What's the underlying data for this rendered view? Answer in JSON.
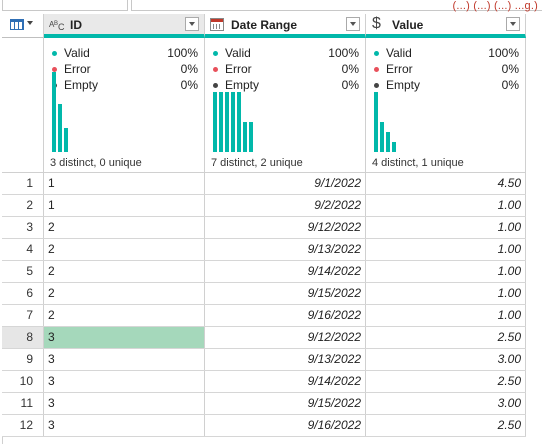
{
  "formula_bar": {
    "tail_text": "(...) (...) (...) ...g.)"
  },
  "columns": [
    {
      "name": "ID",
      "type_icon": "text-type-icon",
      "type_label": "ABC",
      "quality": {
        "valid": "100%",
        "error": "0%",
        "empty": "0%"
      },
      "distribution": [
        80,
        48,
        24
      ],
      "distinct": "3 distinct, 0 unique"
    },
    {
      "name": "Date Range",
      "type_icon": "date-type-icon",
      "quality": {
        "valid": "100%",
        "error": "0%",
        "empty": "0%"
      },
      "distribution": [
        60,
        60,
        60,
        60,
        60,
        30,
        30
      ],
      "distinct": "7 distinct, 2 unique"
    },
    {
      "name": "Value",
      "type_icon": "currency-type-icon",
      "type_label": "$",
      "quality": {
        "valid": "100%",
        "error": "0%",
        "empty": "0%"
      },
      "distribution": [
        60,
        30,
        20,
        10
      ],
      "distinct": "4 distinct, 1 unique"
    }
  ],
  "quality_labels": {
    "valid": "Valid",
    "error": "Error",
    "empty": "Empty"
  },
  "colors": {
    "accent": "#01b8aa",
    "error": "#e8505b",
    "empty": "#444444",
    "selected": "#a5d8bb"
  },
  "rows": [
    {
      "n": "1",
      "id": "1",
      "date": "9/1/2022",
      "value": "4.50"
    },
    {
      "n": "2",
      "id": "1",
      "date": "9/2/2022",
      "value": "1.00"
    },
    {
      "n": "3",
      "id": "2",
      "date": "9/12/2022",
      "value": "1.00"
    },
    {
      "n": "4",
      "id": "2",
      "date": "9/13/2022",
      "value": "1.00"
    },
    {
      "n": "5",
      "id": "2",
      "date": "9/14/2022",
      "value": "1.00"
    },
    {
      "n": "6",
      "id": "2",
      "date": "9/15/2022",
      "value": "1.00"
    },
    {
      "n": "7",
      "id": "2",
      "date": "9/16/2022",
      "value": "1.00"
    },
    {
      "n": "8",
      "id": "3",
      "date": "9/12/2022",
      "value": "2.50",
      "selected": true
    },
    {
      "n": "9",
      "id": "3",
      "date": "9/13/2022",
      "value": "3.00"
    },
    {
      "n": "10",
      "id": "3",
      "date": "9/14/2022",
      "value": "2.50"
    },
    {
      "n": "11",
      "id": "3",
      "date": "9/15/2022",
      "value": "3.00"
    },
    {
      "n": "12",
      "id": "3",
      "date": "9/16/2022",
      "value": "2.50"
    }
  ]
}
